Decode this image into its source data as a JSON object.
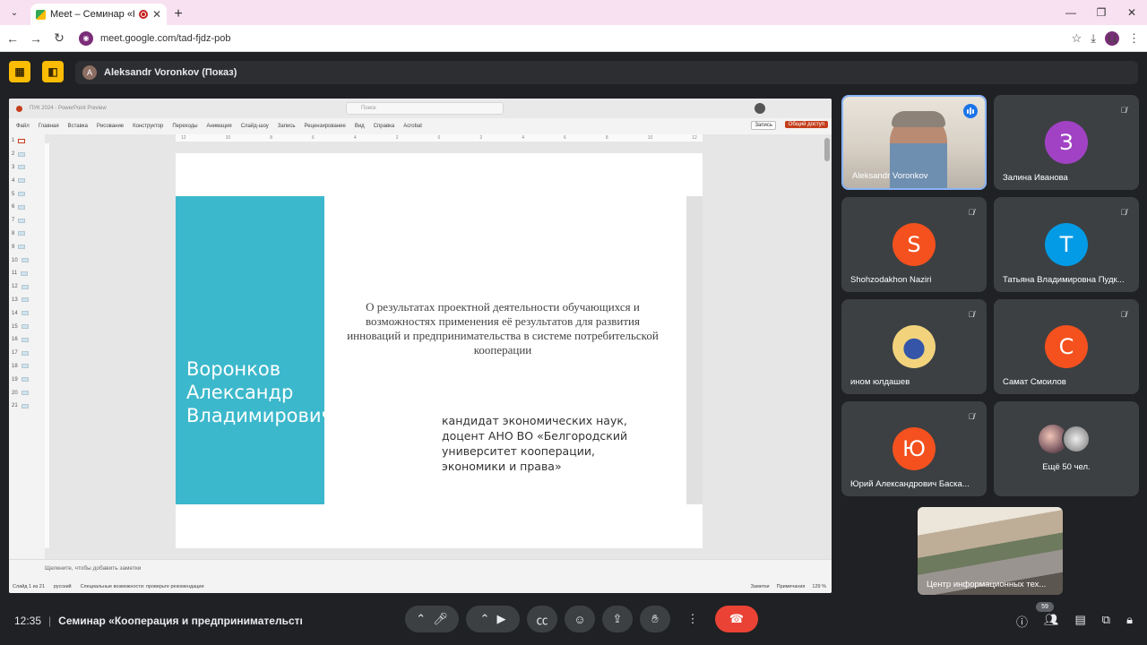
{
  "browser": {
    "tab_title": "Meet – Семинар «Коопер",
    "url": "meet.google.com/tad-fjdz-pob",
    "profile_letter": "Ц"
  },
  "meet": {
    "presenter_initial": "A",
    "presenter_label": "Aleksandr Voronkov (Показ)",
    "clock": "12:35",
    "meeting_title": "Семинар «Кооперация и предпринимательство: с...",
    "participant_count": "59"
  },
  "ppt": {
    "doc_title": "ПУК 2024 - PowerPoint Preview",
    "search_placeholder": "Поиск",
    "menus": [
      "Файл",
      "Главная",
      "Вставка",
      "Рисование",
      "Конструктор",
      "Переходы",
      "Анимация",
      "Слайд-шоу",
      "Запись",
      "Рецензирование",
      "Вид",
      "Справка",
      "Acrobat"
    ],
    "record_btn": "Запись",
    "share_btn": "Общий доступ",
    "slide_numbers": [
      "1",
      "2",
      "3",
      "4",
      "5",
      "6",
      "7",
      "8",
      "9",
      "10",
      "11",
      "12",
      "13",
      "14",
      "15",
      "16",
      "17",
      "18",
      "19",
      "20",
      "21"
    ],
    "notes_placeholder": "Щелкните, чтобы добавить заметки",
    "status_slide": "Слайд 1 из 21",
    "status_lang": "русский",
    "status_access": "Специальные возможности: проверьте рекомендации",
    "status_notes": "Заметки",
    "status_comments": "Примечания",
    "status_zoom": "129 %"
  },
  "slide": {
    "speaker_name": "Воронков Александр Владимирович",
    "topic": "О результатах проектной деятельности обучающихся и возможностях применения её результатов для развития инноваций и предпринимательства в системе потребительской кооперации",
    "credentials": "кандидат экономических наук, доцент АНО ВО «Белгородский университет кооперации, экономики и права»"
  },
  "participants": [
    {
      "name": "Aleksandr Voronkov",
      "type": "video",
      "speaking": true
    },
    {
      "name": "Залина Иванова",
      "initial": "З",
      "color": "#a142c4",
      "muted": true
    },
    {
      "name": "Shohzodakhon Naziri",
      "initial": "S",
      "color": "#f4511e",
      "muted": true
    },
    {
      "name": "Татьяна Владимировна Пудк...",
      "initial": "T",
      "color": "#039be5",
      "muted": true
    },
    {
      "name": "ином юлдашев",
      "type": "photo",
      "muted": true
    },
    {
      "name": "Самат Смоилов",
      "initial": "С",
      "color": "#f4511e",
      "muted": true
    },
    {
      "name": "Юрий Александрович Баска...",
      "initial": "Ю",
      "color": "#f4511e",
      "muted": true
    },
    {
      "name": "",
      "more_label": "Ещё 50 чел."
    }
  ],
  "self_view": {
    "name": "Центр информационных тех..."
  },
  "icons": {
    "mute": "mic-off-icon",
    "mic": "mic-icon",
    "camera": "videocam-icon",
    "captions": "closed-captions-icon",
    "emoji": "emoji-icon",
    "present": "present-screen-icon",
    "hand": "raise-hand-icon",
    "more": "more-vert-icon",
    "end": "call-end-icon"
  }
}
